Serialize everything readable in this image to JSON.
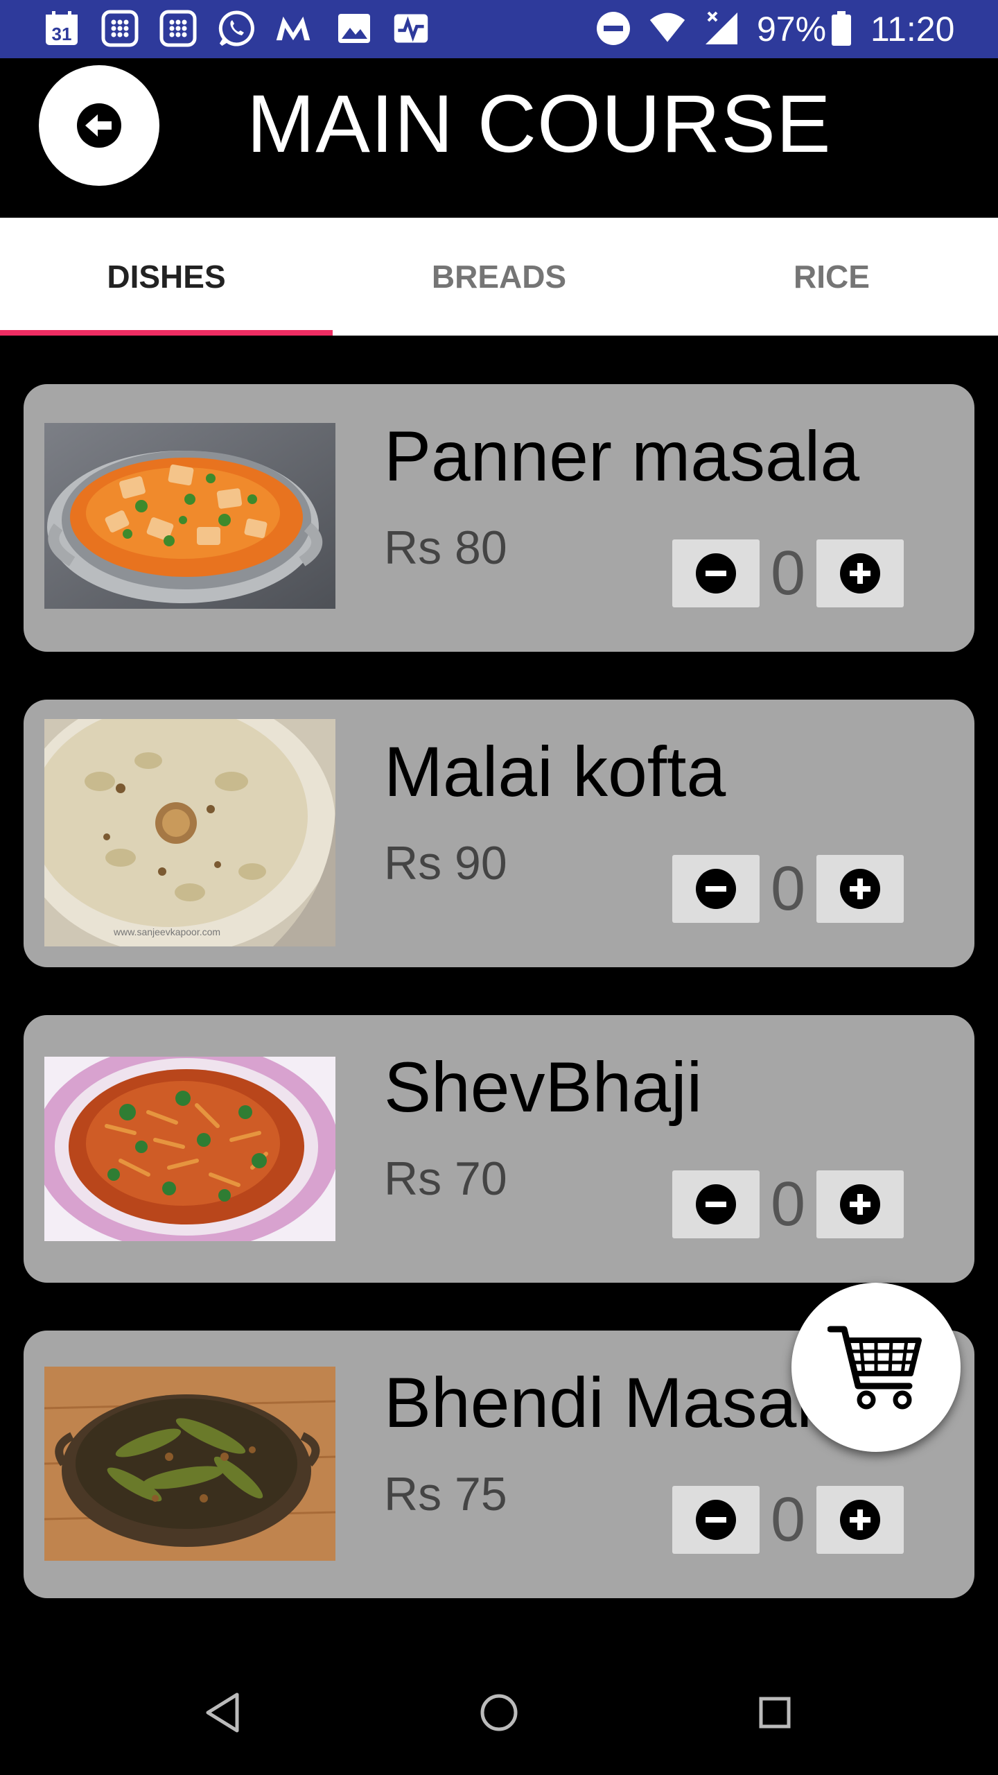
{
  "status_bar": {
    "calendar_day": "31",
    "battery": "97%",
    "time": "11:20",
    "icons": [
      "calendar-icon",
      "dialpad-icon",
      "dialpad-icon",
      "whatsapp-icon",
      "myntra-icon",
      "gallery-icon",
      "activity-icon",
      "dnd-icon",
      "wifi-icon",
      "signal-icon",
      "battery-icon"
    ]
  },
  "header": {
    "title": "MAIN COURSE",
    "back_icon": "back-arrow-icon"
  },
  "tabs": [
    {
      "label": "DISHES",
      "active": true
    },
    {
      "label": "BREADS",
      "active": false
    },
    {
      "label": "RICE",
      "active": false
    }
  ],
  "items": [
    {
      "name": "Panner masala",
      "price": "Rs 80",
      "qty": "0"
    },
    {
      "name": "Malai kofta",
      "price": "Rs 90",
      "qty": "0"
    },
    {
      "name": "ShevBhaji",
      "price": "Rs 70",
      "qty": "0"
    },
    {
      "name": "Bhendi Masala",
      "price": "Rs 75",
      "qty": "0"
    }
  ],
  "watermark": "www.sanjeevkapoor.com",
  "fab_icon": "shopping-cart-icon",
  "nav": [
    "back-icon",
    "home-icon",
    "recents-icon"
  ],
  "colors": {
    "status_bar": "#2e3a9b",
    "tab_indicator": "#ef2d63",
    "card": "#a6a6a6",
    "background": "#000000"
  }
}
